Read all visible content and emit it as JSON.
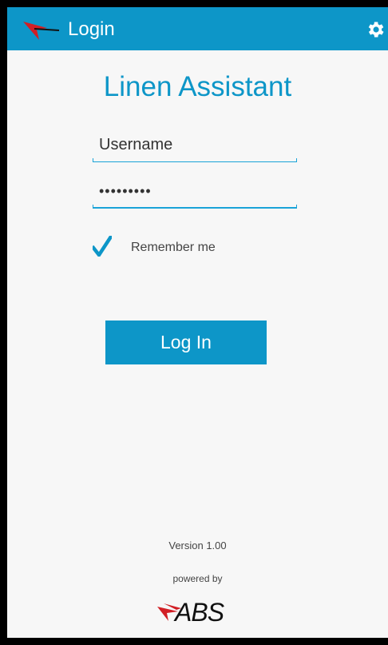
{
  "header": {
    "title": "Login",
    "logo_icon": "abs-logo-icon",
    "settings_icon": "gear-icon"
  },
  "app": {
    "title": "Linen Assistant"
  },
  "form": {
    "username_placeholder": "Username",
    "username_value": "",
    "password_value": "•••••••••",
    "remember_checked": true,
    "remember_label": "Remember me",
    "login_label": "Log In"
  },
  "footer": {
    "version": "Version 1.00",
    "powered_by": "powered by",
    "brand": "ABS"
  },
  "colors": {
    "accent": "#0d96c8",
    "brand_red": "#d21f25",
    "background": "#f7f7f7"
  }
}
